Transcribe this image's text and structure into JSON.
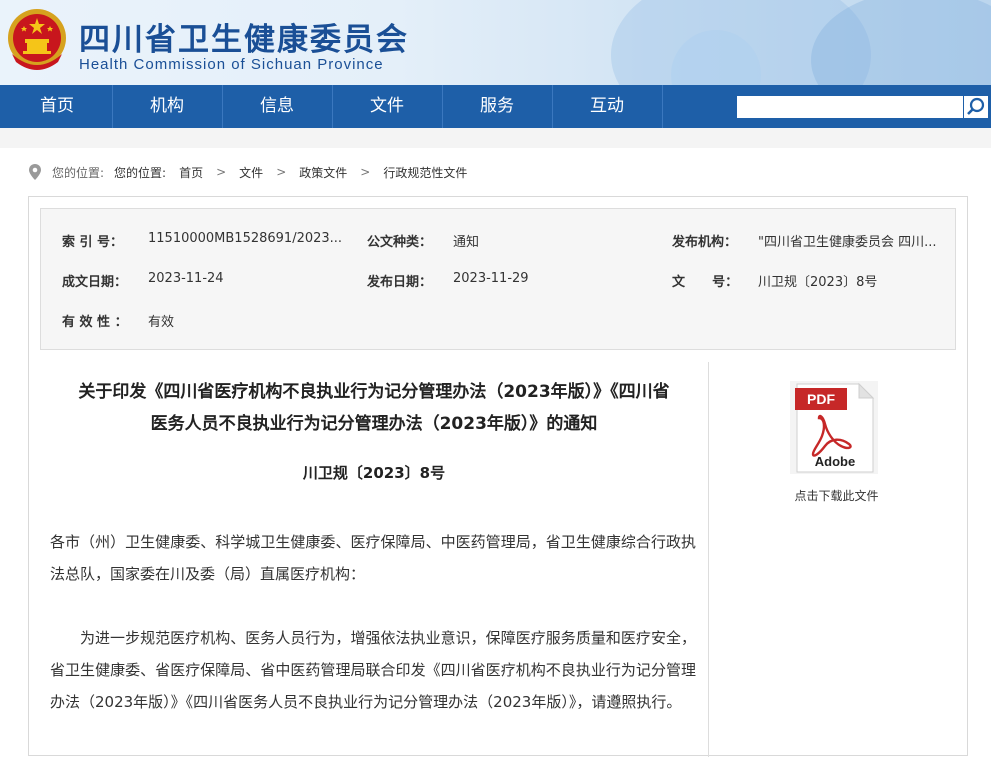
{
  "header": {
    "title": "四川省卫生健康委员会",
    "subtitle": "Health Commission of Sichuan Province"
  },
  "nav": {
    "items": [
      "首页",
      "机构",
      "信息",
      "文件",
      "服务",
      "互动"
    ],
    "search_placeholder": ""
  },
  "breadcrumb": {
    "label": "您的位置:",
    "items": [
      "您的位置:",
      "首页",
      "文件",
      "政策文件",
      "行政规范性文件"
    ]
  },
  "meta": {
    "index_label": "索 引 号：",
    "index_value": "11510000MB1528691/2023...",
    "type_label": "公文种类：",
    "type_value": "通知",
    "publisher_label": "发布机构：",
    "publisher_value": "\"四川省卫生健康委员会 四川...",
    "created_label": "成文日期：",
    "created_value": "2023-11-24",
    "published_label": "发布日期：",
    "published_value": "2023-11-29",
    "docno_label": "文      号：",
    "docno_value": "川卫规〔2023〕8号",
    "validity_label": "有 效 性 ：",
    "validity_value": "有效"
  },
  "content": {
    "title_line1": "关于印发《四川省医疗机构不良执业行为记分管理办法（2023年版）》《四川省",
    "title_line2": "医务人员不良执业行为记分管理办法（2023年版）》的通知",
    "doc_number": "川卫规〔2023〕8号",
    "paragraph1": "各市（州）卫生健康委、科学城卫生健康委、医疗保障局、中医药管理局，省卫生健康综合行政执法总队，国家委在川及委（局）直属医疗机构：",
    "paragraph2": "为进一步规范医疗机构、医务人员行为，增强依法执业意识，保障医疗服务质量和医疗安全，省卫生健康委、省医疗保障局、省中医药管理局联合印发《四川省医疗机构不良执业行为记分管理办法（2023年版）》《四川省医务人员不良执业行为记分管理办法（2023年版）》，请遵照执行。"
  },
  "download": {
    "icon_top": "PDF",
    "icon_bottom": "Adobe",
    "label": "点击下载此文件"
  },
  "colors": {
    "nav_bg": "#1e5fa8",
    "title_blue": "#1a4f96",
    "pdf_red": "#c62828"
  }
}
